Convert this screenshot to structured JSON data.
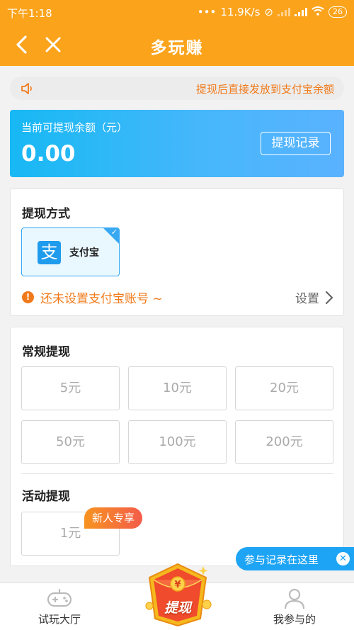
{
  "status_bar": {
    "time": "下午1:18",
    "network_speed": "11.9K/s",
    "battery": "26"
  },
  "nav": {
    "title": "多玩赚"
  },
  "notice": {
    "text": "提现后直接发放到支付宝余额"
  },
  "balance": {
    "label": "当前可提现余额（元）",
    "amount": "0.00",
    "record_button": "提现记录"
  },
  "payment": {
    "title": "提现方式",
    "method": {
      "logo_char": "支",
      "name": "支付宝",
      "selected": true
    },
    "warning": "还未设置支付宝账号 ~",
    "setting_label": "设置"
  },
  "withdraw": {
    "regular_title": "常规提现",
    "regular_options": [
      "5元",
      "10元",
      "20元",
      "50元",
      "100元",
      "200元"
    ],
    "activity_title": "活动提现",
    "activity_options": [
      "1元"
    ],
    "activity_badge": "新人专享"
  },
  "hint": {
    "text": "参与记录在这里"
  },
  "tabbar": {
    "left": "试玩大厅",
    "center": "提现",
    "right": "我参与的"
  },
  "colors": {
    "header": "#fba31b",
    "accent_orange": "#f07a1a",
    "blue": "#1ea4f5",
    "balance_gradient_start": "#17b8f4",
    "balance_gradient_end": "#5ab2ff"
  }
}
